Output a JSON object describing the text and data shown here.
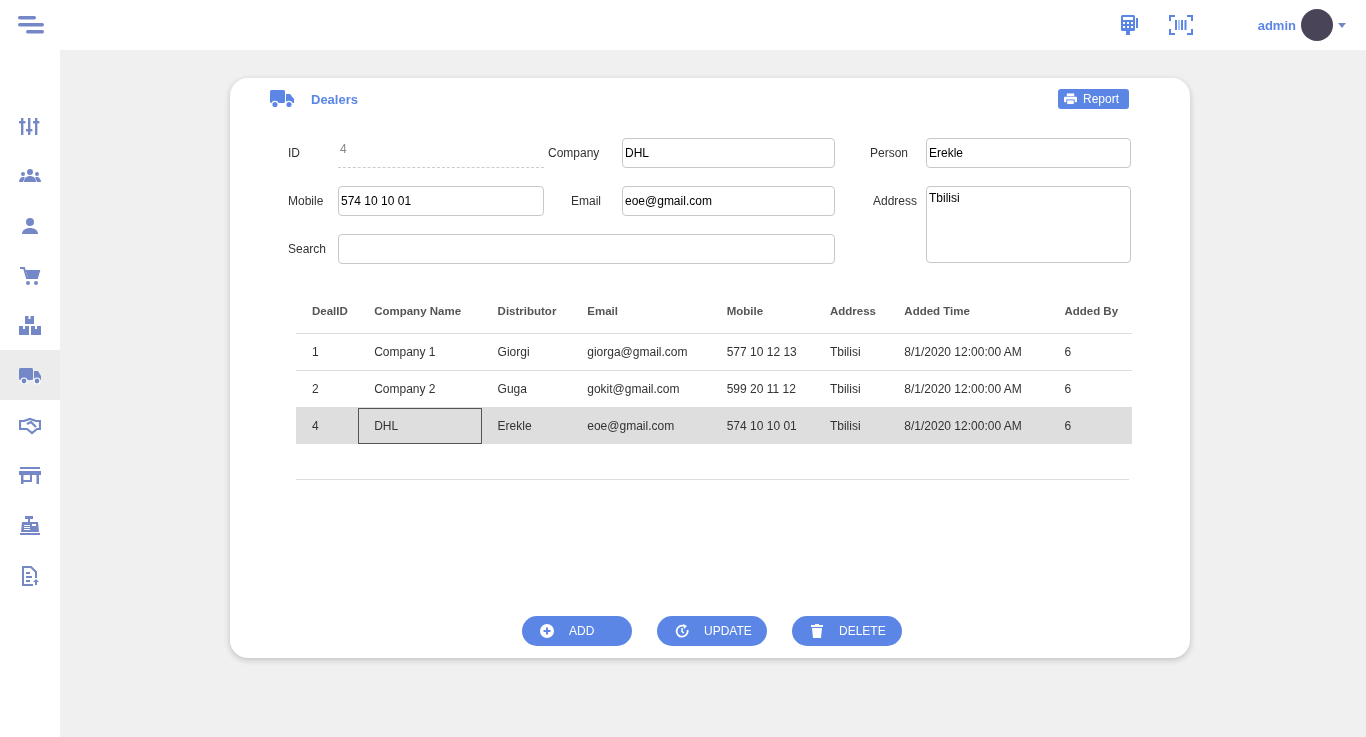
{
  "header": {
    "user": "admin"
  },
  "sidebar": {
    "items": [
      {
        "selected": false
      },
      {
        "selected": false
      },
      {
        "selected": false
      },
      {
        "selected": false
      },
      {
        "selected": false
      },
      {
        "selected": true
      },
      {
        "selected": false
      },
      {
        "selected": false
      },
      {
        "selected": false
      },
      {
        "selected": false
      }
    ]
  },
  "card": {
    "title": "Dealers",
    "report_button": "Report"
  },
  "form": {
    "id": {
      "label": "ID",
      "value": "4"
    },
    "company": {
      "label": "Company",
      "value": "DHL"
    },
    "person": {
      "label": "Person",
      "value": "Erekle"
    },
    "mobile": {
      "label": "Mobile",
      "value": "574 10 10 01"
    },
    "email": {
      "label": "Email",
      "value": "eoe@gmail.com"
    },
    "address": {
      "label": "Address",
      "value": "Tbilisi"
    },
    "search": {
      "label": "Search"
    }
  },
  "table": {
    "columns": [
      "DealID",
      "Company Name",
      "Distributor",
      "Email",
      "Mobile",
      "Address",
      "Added Time",
      "Added By"
    ],
    "rows": [
      {
        "cells": [
          "1",
          "Company 1",
          "Giorgi",
          "giorga@gmail.com",
          "577 10 12 13",
          "Tbilisi",
          "8/1/2020 12:00:00 AM",
          "6"
        ],
        "selected": false
      },
      {
        "cells": [
          "2",
          "Company 2",
          "Guga",
          "gokit@gmail.com",
          "599 20 11 12",
          "Tbilisi",
          "8/1/2020 12:00:00 AM",
          "6"
        ],
        "selected": false
      },
      {
        "cells": [
          "4",
          "DHL",
          "Erekle",
          "eoe@gmail.com",
          "574 10 10 01",
          "Tbilisi",
          "8/1/2020 12:00:00 AM",
          "6"
        ],
        "selected": true
      }
    ]
  },
  "buttons": [
    {
      "kind": "add",
      "label": "ADD"
    },
    {
      "kind": "update",
      "label": "UPDATE"
    },
    {
      "kind": "delete",
      "label": "DELETE"
    }
  ]
}
